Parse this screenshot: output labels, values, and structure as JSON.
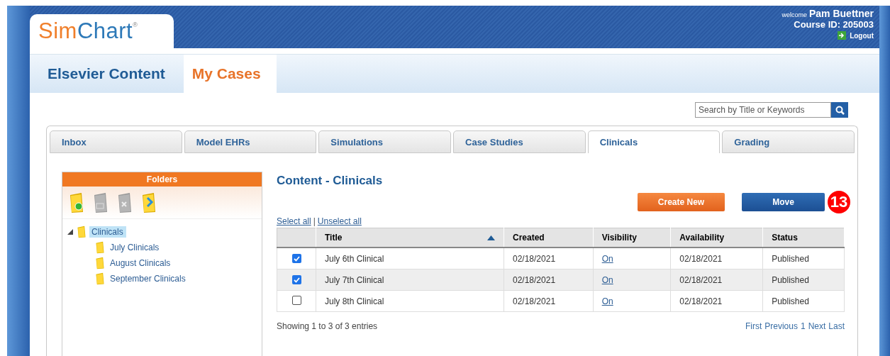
{
  "logo": {
    "prefix": "Sim",
    "suffix": "Chart",
    "mark": "®"
  },
  "user": {
    "welcome": "welcome",
    "name": "Pam Buettner",
    "course": "Course ID: 205003",
    "logout": "Logout"
  },
  "nav_tabs": [
    {
      "label": "Elsevier Content",
      "selected": false
    },
    {
      "label": "My Cases",
      "selected": true
    }
  ],
  "search": {
    "placeholder": "Search by Title or Keywords"
  },
  "tabs": [
    {
      "label": "Inbox",
      "selected": false
    },
    {
      "label": "Model EHRs",
      "selected": false
    },
    {
      "label": "Simulations",
      "selected": false
    },
    {
      "label": "Case Studies",
      "selected": false
    },
    {
      "label": "Clinicals",
      "selected": true
    },
    {
      "label": "Grading",
      "selected": false
    }
  ],
  "folders": {
    "title": "Folders",
    "tools": [
      {
        "kind": "add",
        "disabled": false
      },
      {
        "kind": "copy",
        "disabled": true
      },
      {
        "kind": "delete",
        "disabled": true
      },
      {
        "kind": "move",
        "disabled": false
      }
    ],
    "tree": [
      {
        "label": "Clinicals",
        "selected": true,
        "expanded": true,
        "children": [
          {
            "label": "July Clinicals",
            "selected": false
          },
          {
            "label": "August Clinicals",
            "selected": false
          },
          {
            "label": "September Clinicals",
            "selected": false
          }
        ]
      }
    ]
  },
  "content": {
    "title": "Content - Clinicals",
    "buttons": [
      {
        "label": "Create New",
        "kind": "primary"
      },
      {
        "label": "Move",
        "kind": "secondary"
      }
    ],
    "badge": "13",
    "select_all": "Select all",
    "separator": "|",
    "unselect_all": "Unselect all",
    "columns": [
      {
        "label": "Title",
        "sorted": true
      },
      {
        "label": "Created",
        "sorted": false
      },
      {
        "label": "Visibility",
        "sorted": false
      },
      {
        "label": "Availability",
        "sorted": false
      },
      {
        "label": "Status",
        "sorted": false
      }
    ],
    "rows": [
      {
        "checked": true,
        "title": "July 6th Clinical",
        "created": "02/18/2021",
        "visibility": "On",
        "availability": "02/18/2021",
        "status": "Published"
      },
      {
        "checked": true,
        "title": "July 7th Clinical",
        "created": "02/18/2021",
        "visibility": "On",
        "availability": "02/18/2021",
        "status": "Published"
      },
      {
        "checked": false,
        "title": "July 8th Clinical",
        "created": "02/18/2021",
        "visibility": "On",
        "availability": "02/18/2021",
        "status": "Published"
      }
    ],
    "summary": "Showing 1 to 3 of 3 entries",
    "pagination": [
      "First",
      "Previous",
      "1",
      "Next",
      "Last"
    ]
  }
}
